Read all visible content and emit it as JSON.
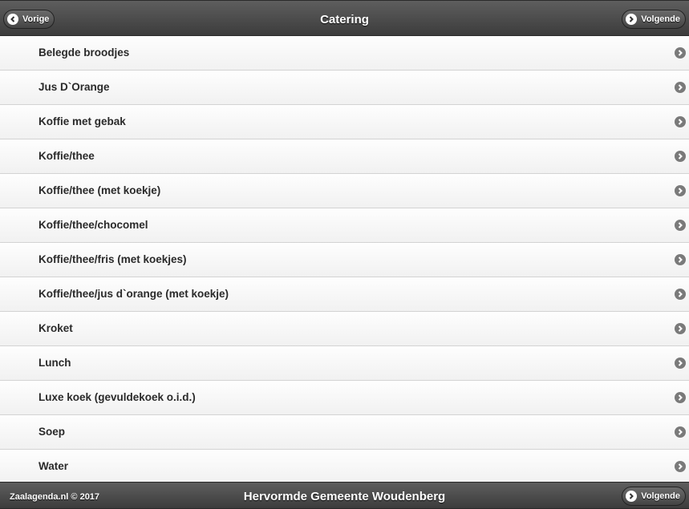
{
  "header": {
    "title": "Catering",
    "prev_label": "Vorige",
    "next_label": "Volgende"
  },
  "items": [
    {
      "label": "Belegde broodjes"
    },
    {
      "label": "Jus D`Orange"
    },
    {
      "label": "Koffie met gebak"
    },
    {
      "label": "Koffie/thee"
    },
    {
      "label": "Koffie/thee (met koekje)"
    },
    {
      "label": "Koffie/thee/chocomel"
    },
    {
      "label": "Koffie/thee/fris (met koekjes)"
    },
    {
      "label": "Koffie/thee/jus d`orange (met koekje)"
    },
    {
      "label": "Kroket"
    },
    {
      "label": "Lunch"
    },
    {
      "label": "Luxe koek (gevuldekoek o.i.d.)"
    },
    {
      "label": "Soep"
    },
    {
      "label": "Water"
    }
  ],
  "footer": {
    "copyright": "Zaalagenda.nl © 2017",
    "title": "Hervormde Gemeente Woudenberg",
    "next_label": "Volgende"
  },
  "icons": {
    "prev": "chevron-left-icon",
    "next": "chevron-right-icon",
    "list_item": "chevron-right-icon"
  }
}
